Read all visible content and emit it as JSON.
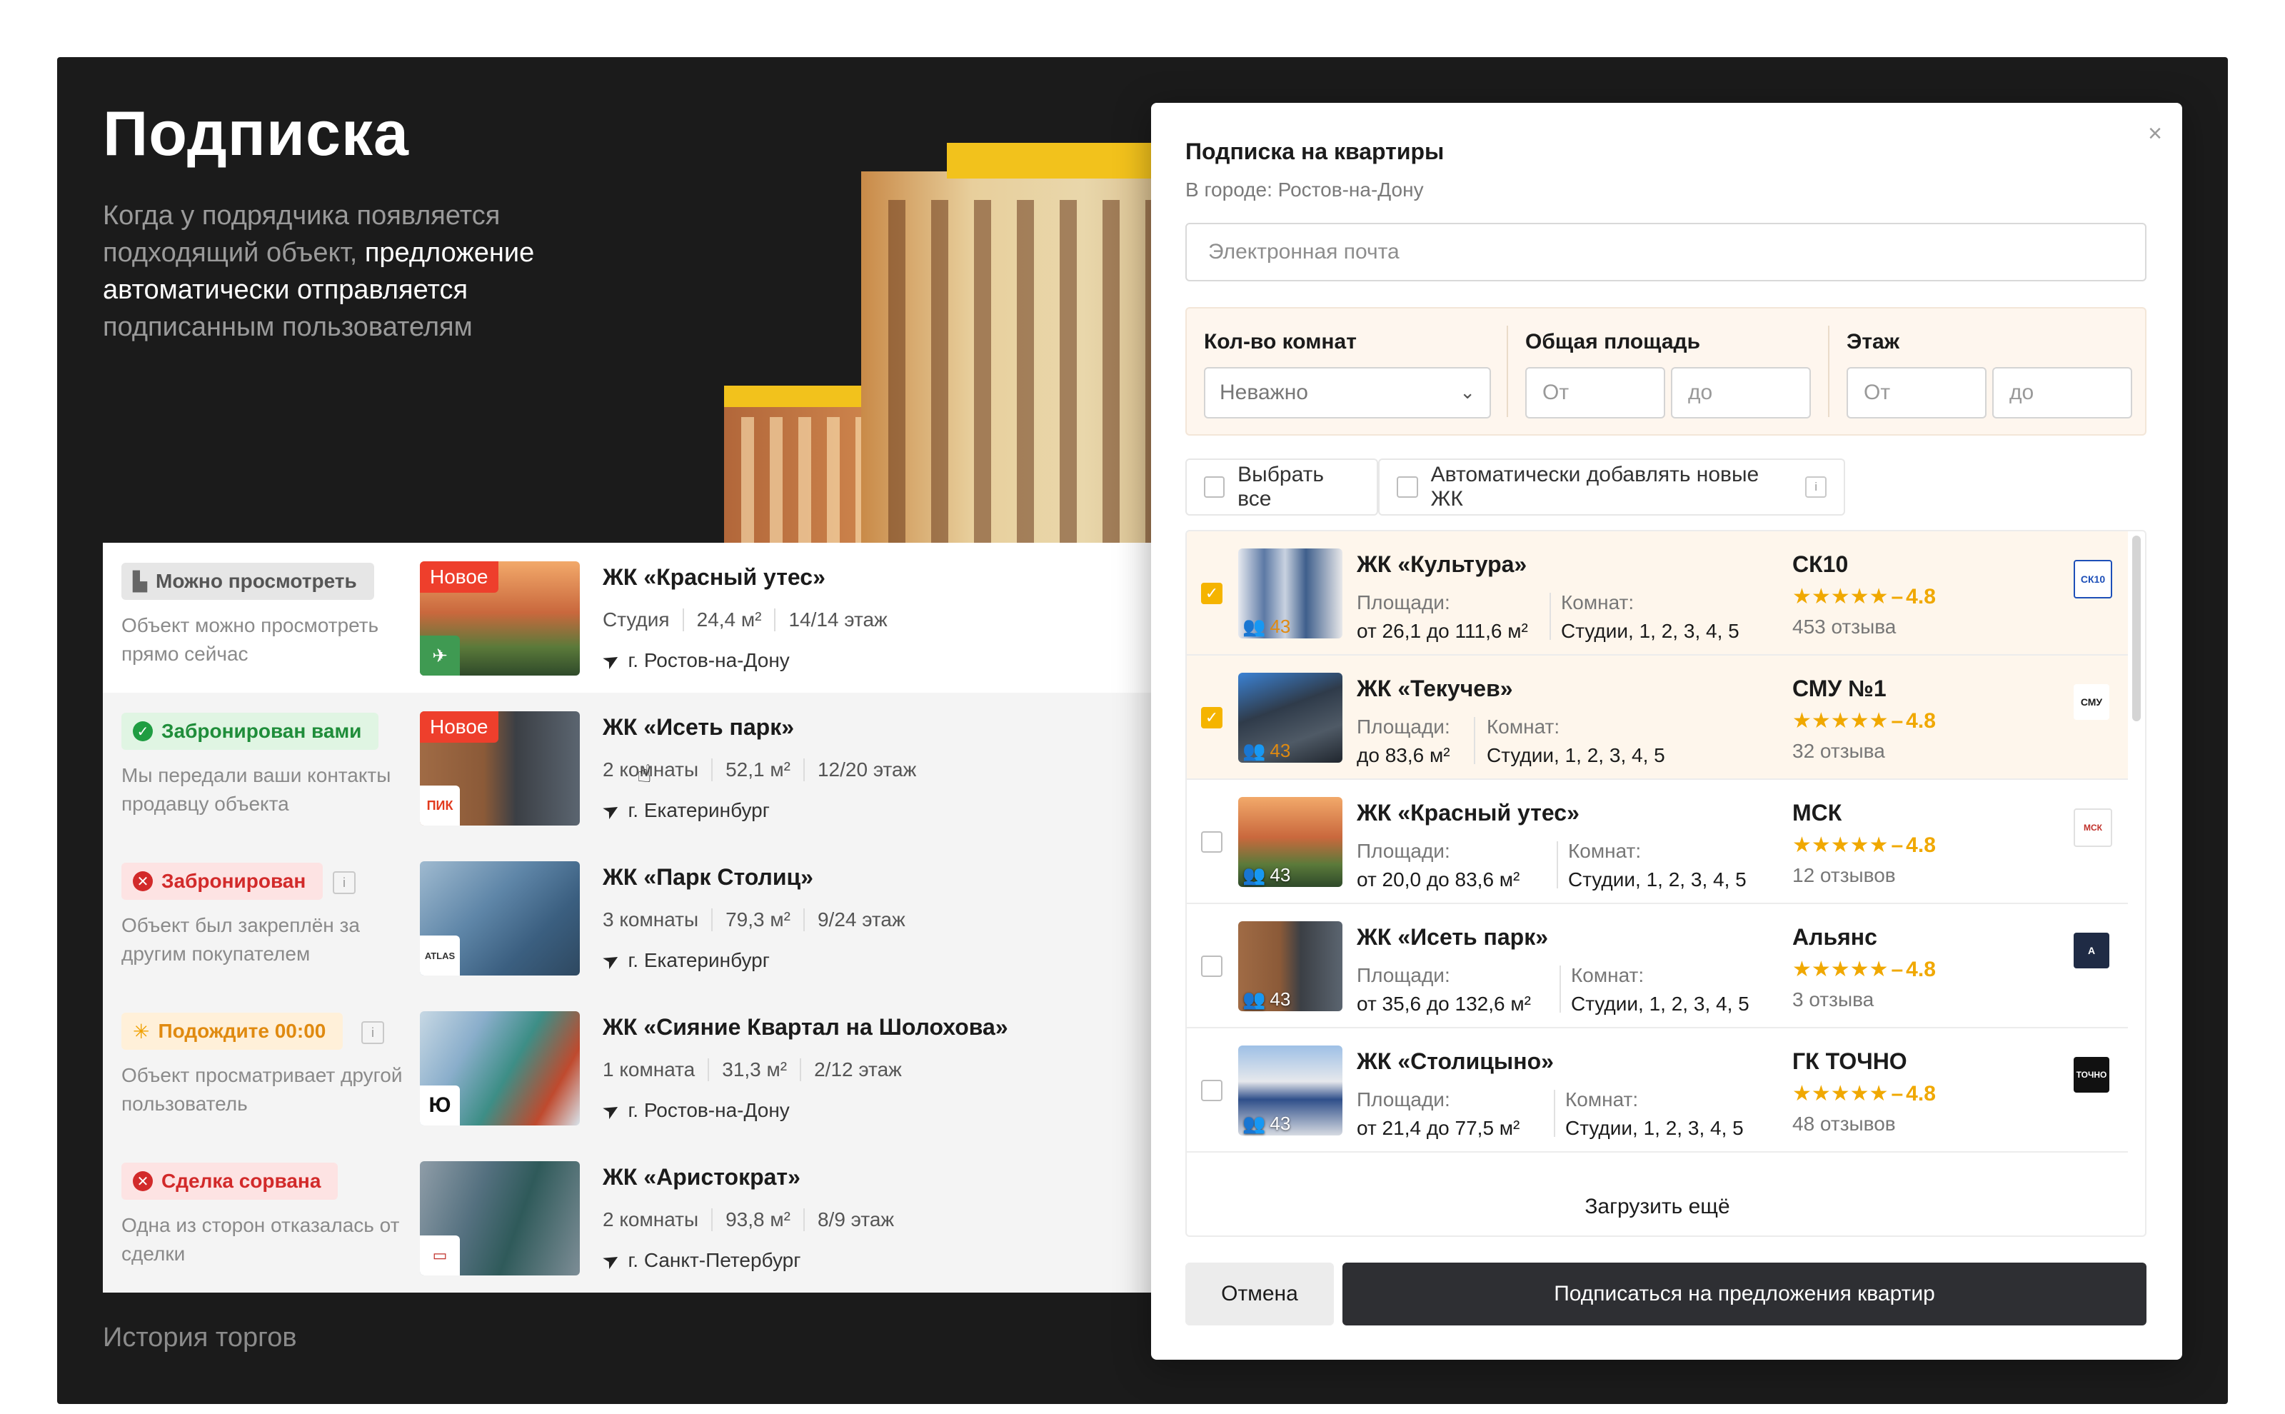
{
  "hero": {
    "title": "Подписка",
    "desc_1": "Когда у подрядчика появляется подходящий объект,",
    "desc_highlight": "предложение автоматически отправляется",
    "desc_2": "подписанным пользователям",
    "history": "История торгов"
  },
  "list": [
    {
      "status": "Можно просмотреть",
      "status_type": "grey",
      "status_icon": "building-icon",
      "note": "Объект можно просмотреть прямо сейчас",
      "new": "Новое",
      "name": "ЖК «Красный утес»",
      "meta": [
        "Студия",
        "24,4 м²",
        "14/14 этаж"
      ],
      "city": "г. Ростов-на-Дону",
      "logo": "bird-logo"
    },
    {
      "status": "Забронирован вами",
      "status_type": "green",
      "status_icon": "check-icon",
      "note": "Мы передали ваши контакты продавцу объекта",
      "new": "Новое",
      "name": "ЖК «Исеть парк»",
      "meta": [
        "2 комнаты",
        "52,1 м²",
        "12/20 этаж"
      ],
      "city": "г. Екатеринбург",
      "logo_text": "ПИК"
    },
    {
      "status": "Забронирован",
      "status_type": "red",
      "status_icon": "close-icon",
      "note": "Объект был закреплён за другим покупателем",
      "name": "ЖК «Парк Столиц»",
      "meta": [
        "3 комнаты",
        "79,3 м²",
        "9/24 этаж"
      ],
      "city": "г. Екатеринбург",
      "logo_text": "ATLAS"
    },
    {
      "status": "Подождите 00:00",
      "status_type": "orange",
      "status_icon": "loading-icon",
      "note": "Объект просматривает другой пользователь",
      "name": "ЖК «Сияние Квартал на Шолохова»",
      "meta": [
        "1 комната",
        "31,3 м²",
        "2/12 этаж"
      ],
      "city": "г. Ростов-на-Дону",
      "logo_text": "Ю"
    },
    {
      "status": "Сделка сорвана",
      "status_type": "red",
      "status_icon": "close-icon",
      "note": "Одна из сторон отказалась от сделки",
      "name": "ЖК «Аристократ»",
      "meta": [
        "2 комнаты",
        "93,8 м²",
        "8/9 этаж"
      ],
      "city": "г. Санкт-Петербург",
      "logo": "developer-logo"
    }
  ],
  "modal": {
    "title": "Подписка на квартиры",
    "subtitle": "В городе: Ростов-на-Дону",
    "email_placeholder": "Электронная почта",
    "filters": {
      "rooms_label": "Кол-во комнат",
      "rooms_value": "Неважно",
      "area_label": "Общая площадь",
      "floor_label": "Этаж",
      "from": "От",
      "to": "до"
    },
    "select_all": "Выбрать все",
    "auto_add": "Автоматически добавлять новые ЖК",
    "load_more": "Загрузить ещё",
    "cancel": "Отмена",
    "subscribe": "Подписаться на предложения квартир",
    "area_label": "Площади:",
    "rooms_label": "Комнат:",
    "projects": [
      {
        "name": "ЖК «Культура»",
        "checked": true,
        "count": "43",
        "area": "от 26,1 до 111,6 м²",
        "rooms": "Студии, 1, 2, 3, 4, 5",
        "dev": "СК10",
        "rating": "4.8",
        "reviews": "453 отзыва",
        "logo_text": "СК10"
      },
      {
        "name": "ЖК «Текучев»",
        "checked": true,
        "count": "43",
        "area": "до 83,6 м²",
        "rooms": "Студии, 1, 2, 3, 4, 5",
        "dev": "СМУ №1",
        "rating": "4.8",
        "reviews": "32 отзыва",
        "logo_text": "СМУ"
      },
      {
        "name": "ЖК «Красный утес»",
        "checked": false,
        "count": "43",
        "area": "от 20,0 до 83,6 м²",
        "rooms": "Студии, 1, 2, 3, 4, 5",
        "dev": "МСК",
        "rating": "4.8",
        "reviews": "12 отзывов",
        "logo_text": "МСК"
      },
      {
        "name": "ЖК «Исеть парк»",
        "checked": false,
        "count": "43",
        "area": "от 35,6 до 132,6 м²",
        "rooms": "Студии, 1, 2, 3, 4, 5",
        "dev": "Альянс",
        "rating": "4.8",
        "reviews": "3 отзыва",
        "logo_text": "A"
      },
      {
        "name": "ЖК «Столицыно»",
        "checked": false,
        "count": "43",
        "area": "от 21,4 до 77,5 м²",
        "rooms": "Студии, 1, 2, 3, 4, 5",
        "dev": "ГК ТОЧНО",
        "rating": "4.8",
        "reviews": "48 отзывов",
        "logo_text": "ТОЧНО"
      }
    ]
  },
  "colors": {
    "dark_bg": "#1b1b1b",
    "accent": "#f5b400",
    "star": "#f0a800",
    "new_badge": "#ee3f2c",
    "primary_btn": "#2e2f33"
  }
}
